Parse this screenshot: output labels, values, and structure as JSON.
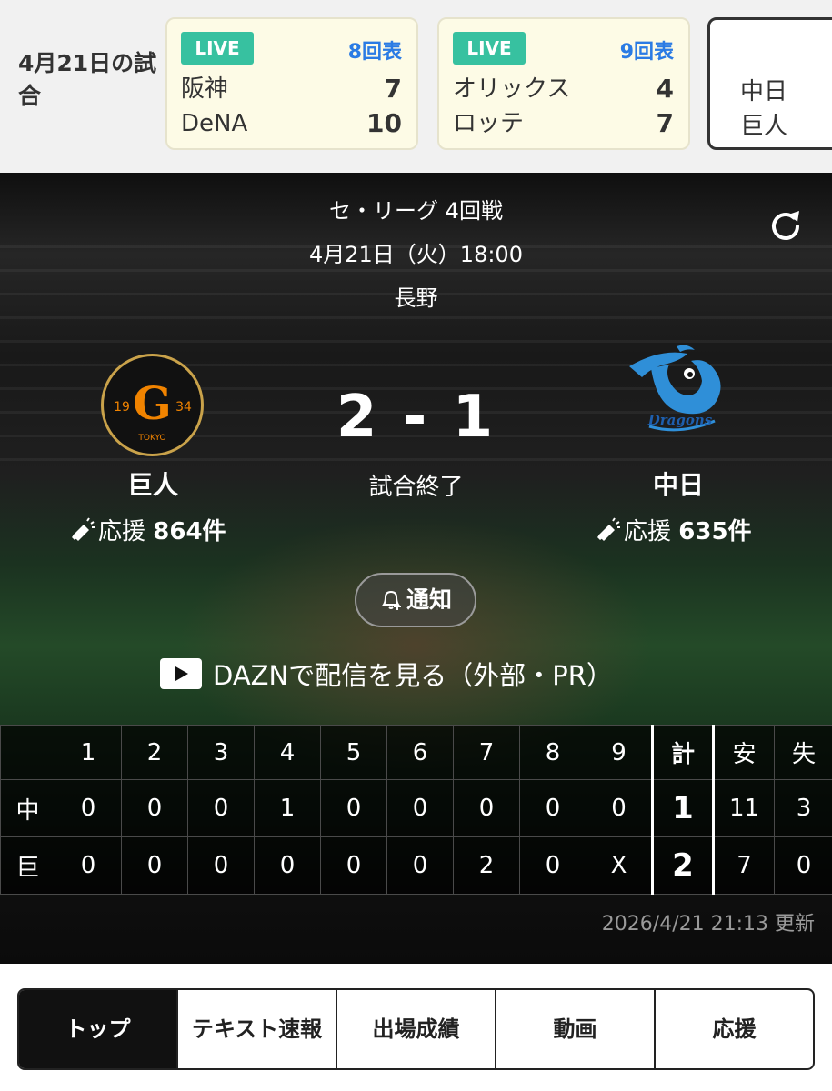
{
  "date_label": "4月21日の試合",
  "games": [
    {
      "badge": "LIVE",
      "inning": "8回表",
      "teams": [
        {
          "name": "阪神",
          "score": "7"
        },
        {
          "name": "DeNA",
          "score": "10"
        }
      ]
    },
    {
      "badge": "LIVE",
      "inning": "9回表",
      "teams": [
        {
          "name": "オリックス",
          "score": "4"
        },
        {
          "name": "ロッテ",
          "score": "7"
        }
      ]
    },
    {
      "teams": [
        {
          "name": "中日"
        },
        {
          "name": "巨人"
        }
      ]
    }
  ],
  "match": {
    "league": "セ・リーグ 4回戦",
    "datetime": "4月21日（火）18:00",
    "venue": "長野",
    "score": "2 - 1",
    "status": "試合終了",
    "home": {
      "name": "巨人",
      "cheer_label": "応援",
      "cheer_count": "864件",
      "logo_top": "19",
      "logo_letter": "G",
      "logo_right": "34",
      "logo_bottom": "TOKYO"
    },
    "away": {
      "name": "中日",
      "cheer_label": "応援",
      "cheer_count": "635件",
      "logo_text": "Dragons"
    },
    "notify_label": "通知",
    "dazn_label": "DAZNで配信を見る（外部・PR）"
  },
  "scoreboard": {
    "headers": [
      "",
      "1",
      "2",
      "3",
      "4",
      "5",
      "6",
      "7",
      "8",
      "9",
      "計",
      "安",
      "失"
    ],
    "rows": [
      {
        "team": "中",
        "innings": [
          "0",
          "0",
          "0",
          "1",
          "0",
          "0",
          "0",
          "0",
          "0"
        ],
        "total": "1",
        "hits": "11",
        "errors": "3"
      },
      {
        "team": "巨",
        "innings": [
          "0",
          "0",
          "0",
          "0",
          "0",
          "0",
          "2",
          "0",
          "X"
        ],
        "total": "2",
        "hits": "7",
        "errors": "0"
      }
    ],
    "updated": "2026/4/21 21:13 更新"
  },
  "tabs": [
    "トップ",
    "テキスト速報",
    "出場成績",
    "動画",
    "応援"
  ],
  "colors": {
    "live_badge": "#37c1a0",
    "inning_text": "#2a7be4",
    "giants_orange": "#f08300",
    "dragons_blue": "#2f8fd8"
  }
}
